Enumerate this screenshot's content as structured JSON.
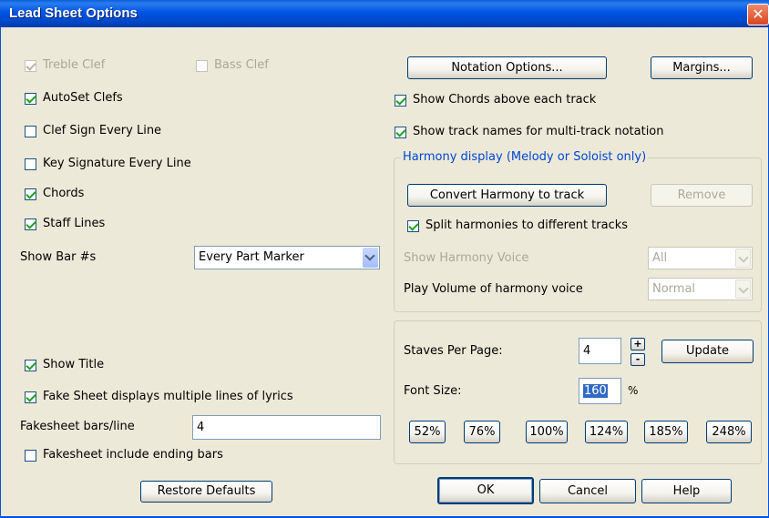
{
  "window": {
    "title": "Lead Sheet Options",
    "close_label": "✕"
  },
  "left": {
    "treble_clef": "Treble Clef",
    "bass_clef": "Bass Clef",
    "autoset_clefs": "AutoSet Clefs",
    "clef_sign_every_line": "Clef Sign Every Line",
    "key_signature_every_line": "Key Signature Every Line",
    "chords": "Chords",
    "staff_lines": "Staff Lines",
    "show_bar_label": "Show Bar #s",
    "show_bar_value": "Every Part Marker",
    "show_title": "Show Title",
    "fake_sheet_lyrics": "Fake Sheet displays multiple lines of lyrics",
    "fakesheet_bars_label": "Fakesheet bars/line",
    "fakesheet_bars_value": "4",
    "fakesheet_ending_bars": "Fakesheet include ending bars",
    "restore_defaults": "Restore Defaults"
  },
  "right": {
    "notation_options": "Notation Options...",
    "margins": "Margins...",
    "show_chords_above": "Show Chords above each track",
    "show_track_names": "Show track names for multi-track notation",
    "harmony_group_title": "Harmony display (Melody or Soloist only)",
    "convert_harmony": "Convert Harmony to track",
    "remove": "Remove",
    "split_harmonies": "Split harmonies to different tracks",
    "show_harmony_voice_label": "Show Harmony Voice",
    "show_harmony_voice_value": "All",
    "play_volume_label": "Play Volume of harmony voice",
    "play_volume_value": "Normal",
    "staves_per_page_label": "Staves Per Page:",
    "staves_per_page_value": "4",
    "spin_up": "+",
    "spin_down": "-",
    "update": "Update",
    "font_size_label": "Font Size:",
    "font_size_value": "160",
    "percent_sign": "%",
    "presets": [
      "52%",
      "76%",
      "100%",
      "124%",
      "185%",
      "248%"
    ]
  },
  "footer": {
    "ok": "OK",
    "cancel": "Cancel",
    "help": "Help"
  }
}
